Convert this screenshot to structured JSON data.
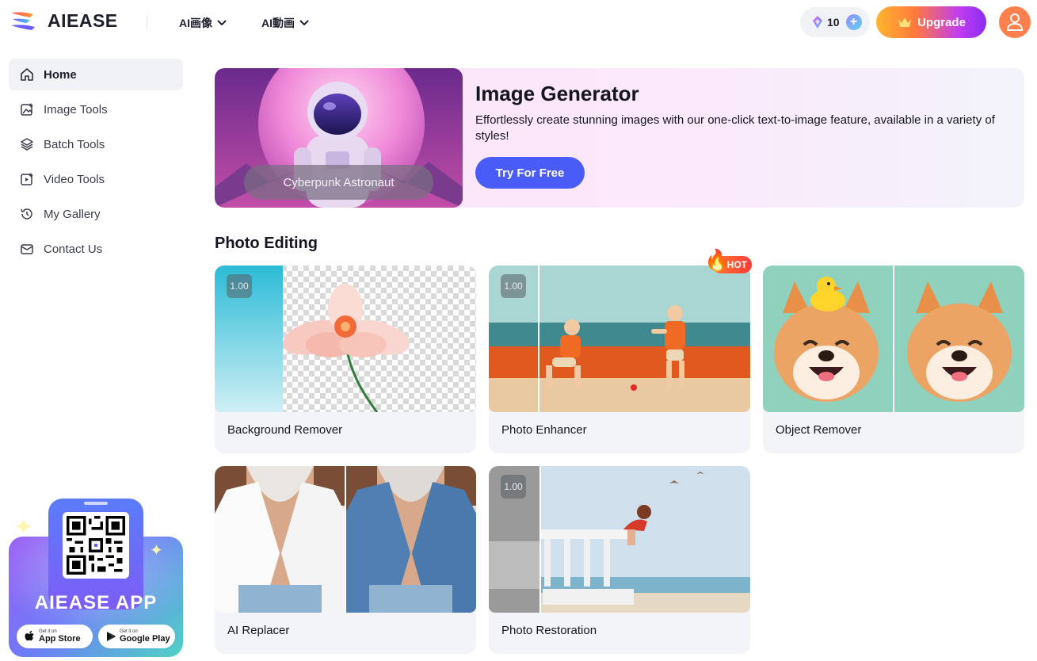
{
  "header": {
    "logo_text": "AIEASE",
    "nav": [
      {
        "label": "AI画像"
      },
      {
        "label": "AI動画"
      }
    ],
    "credits_count": "10",
    "credits_plus": "+",
    "upgrade_label": "Upgrade"
  },
  "sidebar": {
    "items": [
      {
        "label": "Home",
        "icon": "home-icon"
      },
      {
        "label": "Image Tools",
        "icon": "image-tools-icon"
      },
      {
        "label": "Batch Tools",
        "icon": "layers-icon"
      },
      {
        "label": "Video Tools",
        "icon": "video-tools-icon"
      },
      {
        "label": "My Gallery",
        "icon": "history-icon"
      },
      {
        "label": "Contact Us",
        "icon": "mail-icon"
      }
    ],
    "app_promo": {
      "title": "AIEASE APP",
      "app_store_small": "Get it on",
      "app_store_big": "App Store",
      "google_play_small": "Get it on",
      "google_play_big": "Google Play"
    }
  },
  "banner": {
    "image_caption": "Cyberpunk Astronaut",
    "title": "Image Generator",
    "description": "Effortlessly create stunning images with our one-click text-to-image feature, available in a variety of styles!",
    "button_label": "Try For Free"
  },
  "photo_editing": {
    "section_title": "Photo Editing",
    "badge_text": "1.00",
    "hot_label": "HOT",
    "cards": [
      {
        "label": "Background Remover"
      },
      {
        "label": "Photo Enhancer"
      },
      {
        "label": "Object Remover"
      },
      {
        "label": "AI Replacer"
      },
      {
        "label": "Photo Restoration"
      }
    ]
  },
  "colors": {
    "accent_blue": "#4a5cf8",
    "upgrade_gradient_start": "#ffb52e",
    "upgrade_gradient_end": "#8a2cf2",
    "avatar_orange": "#ff7f4d",
    "sidebar_active_bg": "#f1f2f6"
  }
}
